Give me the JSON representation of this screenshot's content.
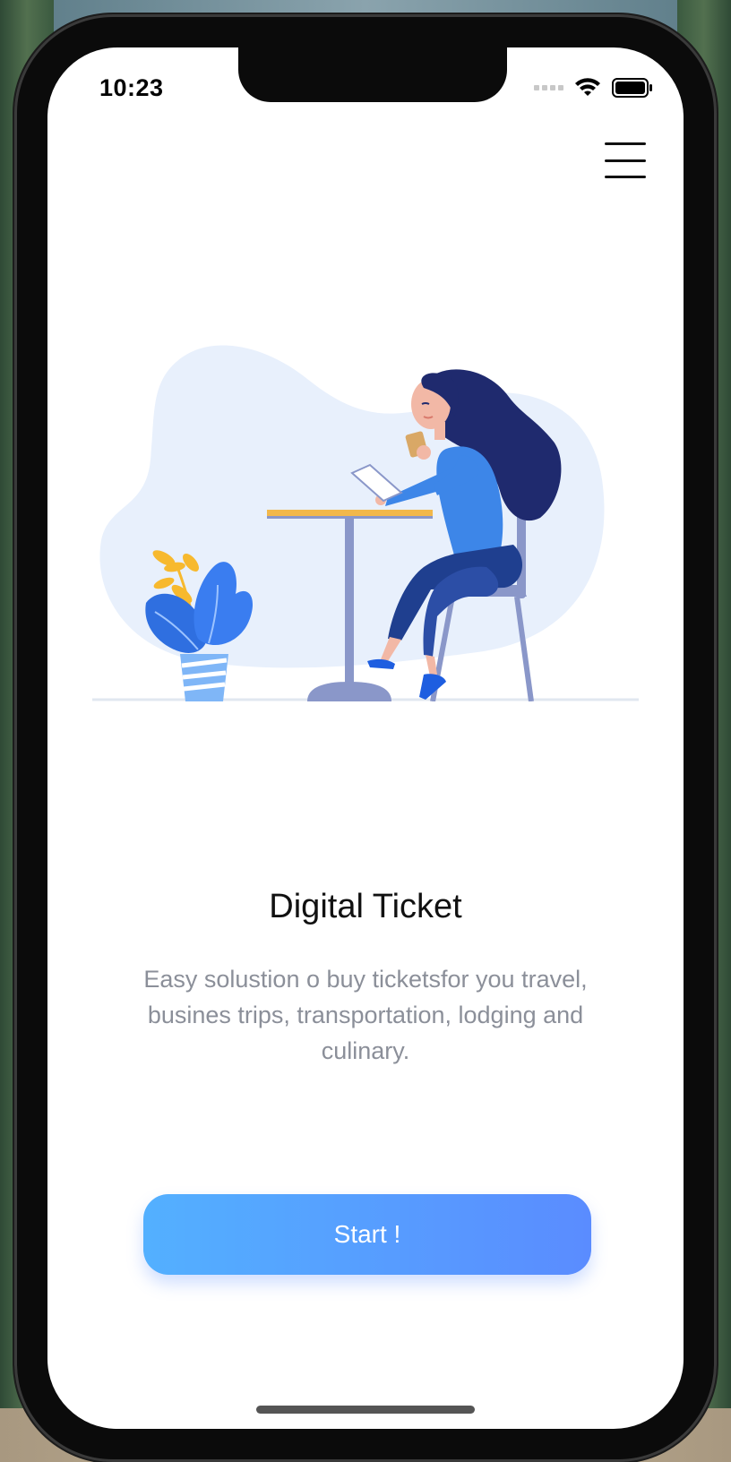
{
  "status_bar": {
    "time": "10:23"
  },
  "icons": {
    "menu": "hamburger-menu-icon",
    "wifi": "wifi-icon",
    "battery": "battery-icon",
    "signal": "cellular-signal-icon"
  },
  "onboarding": {
    "title": "Digital Ticket",
    "description": "Easy solustion o buy ticketsfor you travel, busines trips, transportation, lodging and culinary.",
    "start_label": "Start !"
  },
  "colors": {
    "button_gradient_start": "#53b0ff",
    "button_gradient_end": "#5a8cff",
    "description_text": "#8b8f99",
    "illustration_blob": "#e8f0fc"
  }
}
